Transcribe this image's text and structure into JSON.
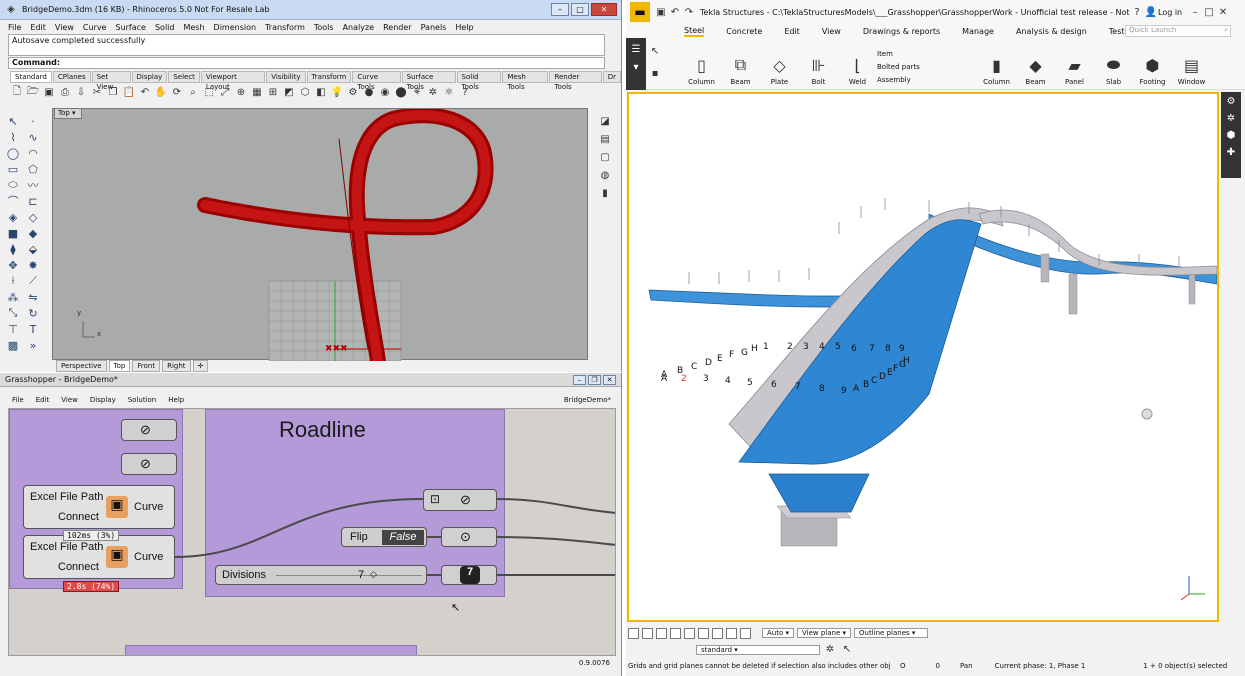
{
  "rhino": {
    "title": "BridgeDemo.3dm (16 KB) - Rhinoceros 5.0 Not For Resale Lab",
    "menu": [
      "File",
      "Edit",
      "View",
      "Curve",
      "Surface",
      "Solid",
      "Mesh",
      "Dimension",
      "Transform",
      "Tools",
      "Analyze",
      "Render",
      "Panels",
      "Help"
    ],
    "history": "Autosave completed successfully",
    "command_label": "Command:",
    "tabs": [
      "Standard",
      "CPlanes",
      "Set View",
      "Display",
      "Select",
      "Viewport Layout",
      "Visibility",
      "Transform",
      "Curve Tools",
      "Surface Tools",
      "Solid Tools",
      "Mesh Tools",
      "Render Tools",
      "Dr"
    ],
    "viewport_name": "Top",
    "viewport_tabs": [
      "Perspective",
      "Top",
      "Front",
      "Right"
    ],
    "axis_x": "x",
    "axis_y": "y"
  },
  "grasshopper": {
    "title": "Grasshopper - BridgeDemo*",
    "menu": [
      "File",
      "Edit",
      "View",
      "Display",
      "Solution",
      "Help"
    ],
    "doc_name": "BridgeDemo*",
    "group_title": "Roadline",
    "excel1": {
      "input_top": "Excel File Path",
      "input_bot": "Connect",
      "output": "Curve"
    },
    "excel2": {
      "input_top": "Excel File Path",
      "input_bot": "Connect",
      "output": "Curve",
      "time1": "102ms (3%)",
      "time2": "2.8s (74%)"
    },
    "flip": {
      "label": "Flip",
      "value": "False"
    },
    "divisions": {
      "label": "Divisions",
      "value": "7"
    },
    "status_zoom": "0.9.0076"
  },
  "tekla": {
    "title": "Tekla Structures - C:\\TeklaStructuresModels\\___Grasshopper\\GrasshopperWork - Unofficial test release - Not for produc...",
    "login": "Log in",
    "tabs": [
      "Steel",
      "Concrete",
      "Edit",
      "View",
      "Drawings & reports",
      "Manage",
      "Analysis & design",
      "Test"
    ],
    "quick_launch": "Quick Launch",
    "ribbon_items": [
      "Column",
      "Beam",
      "Plate",
      "Bolt",
      "Weld",
      "Column",
      "Beam",
      "Panel",
      "Slab",
      "Footing",
      "Window"
    ],
    "ribbon_small": [
      "Item",
      "Bolted parts",
      "Assembly"
    ],
    "point_labels_a": [
      "A",
      "B",
      "C",
      "D",
      "E",
      "F",
      "G",
      "H",
      "1",
      "2",
      "3",
      "4",
      "5",
      "6",
      "7",
      "8",
      "9"
    ],
    "point_labels_b": [
      "A",
      "2",
      "3",
      "4",
      "5",
      "6",
      "7",
      "8",
      "9",
      "A",
      "B",
      "C",
      "D",
      "E",
      "F",
      "G",
      "H"
    ],
    "bar": {
      "auto": "Auto",
      "view_plane": "View plane",
      "outline": "Outline planes"
    },
    "filter": "standard",
    "status": {
      "msg": "Grids and grid planes cannot be deleted if selection also includes other objec",
      "o": "O",
      "zero": "0",
      "pan": "Pan",
      "phase": "Current phase: 1, Phase 1",
      "selected": "1 + 0 object(s) selected"
    }
  },
  "colors": {
    "tekla_accent": "#f2b800",
    "bridge_blue": "#2f86d3",
    "gh_group": "#b49ad8",
    "rhino_curve": "#b30000"
  }
}
